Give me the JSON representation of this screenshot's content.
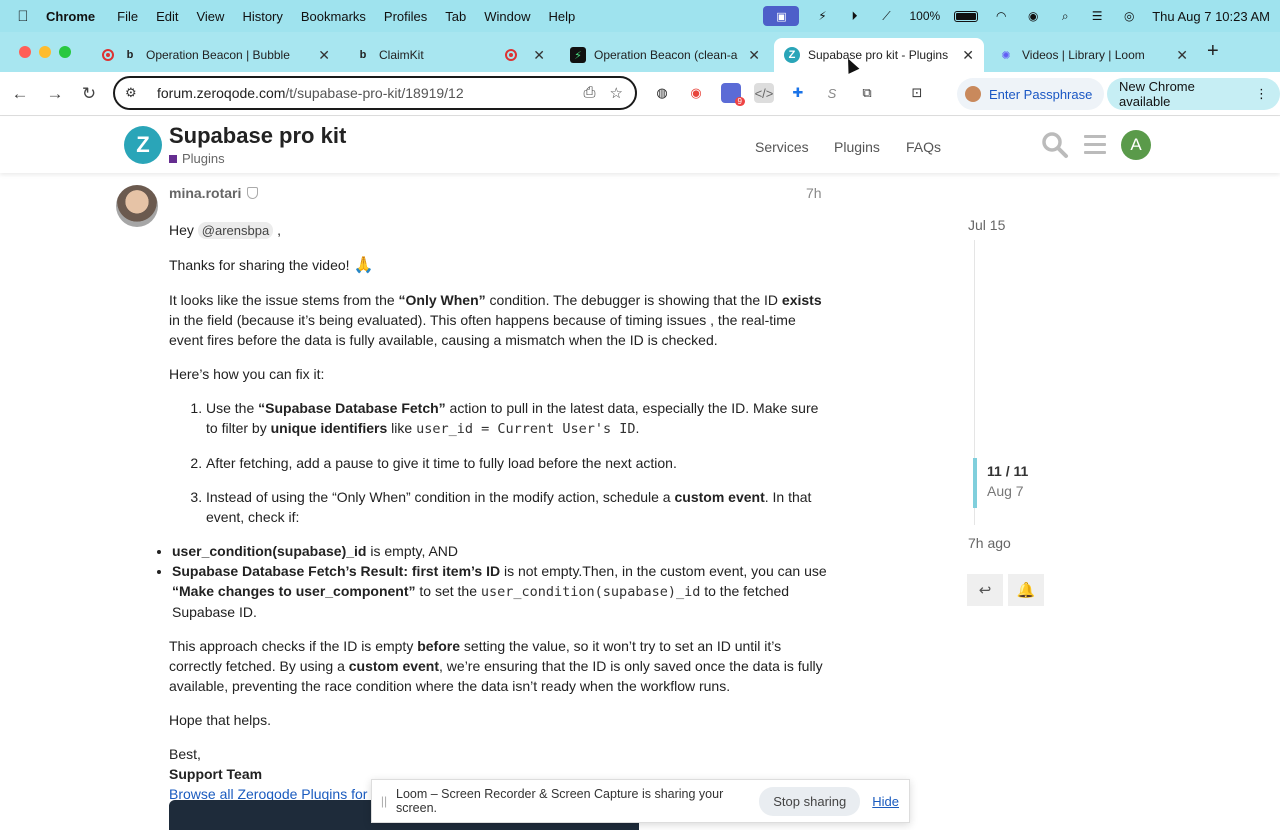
{
  "menubar": {
    "app": "Chrome",
    "items": [
      "File",
      "Edit",
      "View",
      "History",
      "Bookmarks",
      "Profiles",
      "Tab",
      "Window",
      "Help"
    ],
    "battery": "100%",
    "datetime": "Thu Aug 7  10:23 AM"
  },
  "tabs": [
    {
      "title": "Operation Beacon | Bubble",
      "favicon": "b"
    },
    {
      "title": "ClaimKit",
      "favicon": "b"
    },
    {
      "title": "Operation Beacon (clean-a",
      "favicon": "⚡"
    },
    {
      "title": "Supabase pro kit - Plugins",
      "favicon": "Z"
    },
    {
      "title": "Videos | Library | Loom",
      "favicon": "✺"
    }
  ],
  "toolbar": {
    "url_host": "forum.zeroqode.com",
    "url_path": "/t/supabase-pro-kit/18919/12",
    "ext_badge": "9",
    "passphrase": "Enter Passphrase",
    "update": "New Chrome available"
  },
  "header": {
    "logo": "Z",
    "title": "Supabase pro kit",
    "category": "Plugins",
    "nav": [
      "Services",
      "Plugins",
      "FAQs"
    ],
    "avatar": "A"
  },
  "post": {
    "username": "mina.rotari",
    "age": "7h",
    "greeting_pre": "Hey ",
    "mention": "@arensbpa",
    "greeting_post": " ,",
    "thanks": "Thanks for sharing the video!",
    "pray": "🙏",
    "p1_a": "It looks like the issue stems from the ",
    "p1_b": "“Only When”",
    "p1_c": " condition. The debugger is showing that the ID ",
    "p1_d": "exists",
    "p1_e": " in the field (because it’s being evaluated). This often happens because of timing issues , the real-time event fires before the data is fully available, causing a mismatch when the ID is checked.",
    "howto": "Here’s how you can fix it:",
    "s1_a": "Use the ",
    "s1_b": "“Supabase Database Fetch”",
    "s1_c": " action to pull in the latest data, especially the ID. Make sure to filter by ",
    "s1_d": "unique identifiers",
    "s1_e": " like ",
    "s1_code": "user_id = Current User's ID",
    "s1_f": ".",
    "s2": "After fetching, add a pause to give it time to fully load before the next action.",
    "s3_a": "Instead of using the “Only When” condition in the modify action, schedule a ",
    "s3_b": "custom event",
    "s3_c": ". In that event, check if:",
    "b1_a": "user_condition(supabase)_id",
    "b1_b": " is empty, AND",
    "b2_a": "Supabase Database Fetch’s Result: first item’s ID",
    "b2_b": " is not empty.Then, in the custom event, you can use ",
    "b2_c": "“Make changes to user_component”",
    "b2_d": " to set the ",
    "b2_code": "user_condition(supabase)_id",
    "b2_e": " to the fetched Supabase ID.",
    "p2_a": "This approach checks if the ID is empty ",
    "p2_b": "before",
    "p2_c": " setting the value, so it won’t try to set an ID until it’s correctly fetched. By using a ",
    "p2_d": "custom event",
    "p2_e": ", we’re ensuring that the ID is only saved once the data is fully available, preventing the race condition where the data isn’t ready when the workflow runs.",
    "hope": "Hope that helps.",
    "best": "Best,",
    "team": "Support Team",
    "browse": "Browse all Zeroqode Plugins for"
  },
  "timeline": {
    "top_date": "Jul 15",
    "count": "11 / 11",
    "date": "Aug 7",
    "ago": "7h ago"
  },
  "share_bar": {
    "message": "Loom – Screen Recorder & Screen Capture is sharing your screen.",
    "stop": "Stop sharing",
    "hide": "Hide"
  },
  "colors": {
    "menubar": "#9fe3ee",
    "tabstrip": "#a8e6f0",
    "brand": "#2aa5b8",
    "category": "#652d90",
    "link": "#1a5bbf"
  }
}
